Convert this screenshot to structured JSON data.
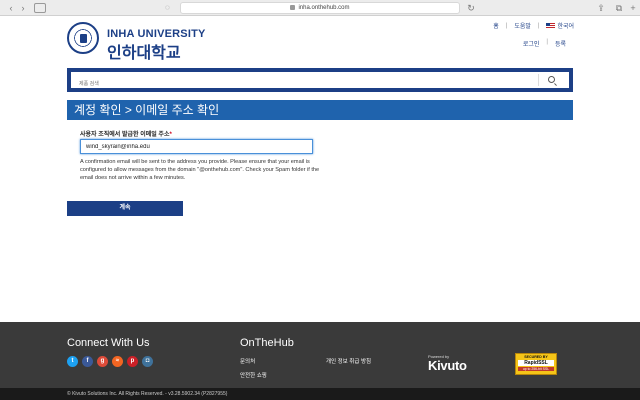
{
  "browser": {
    "url": "inha.onthehub.com"
  },
  "header": {
    "logo_en": "INHA UNIVERSITY",
    "logo_ko": "인하대학교",
    "top_links": [
      "홈",
      "도움말",
      "한국어"
    ],
    "login": "로그인",
    "register": "등록"
  },
  "search": {
    "placeholder": "제품 검색"
  },
  "page": {
    "title": "계정 확인 > 이메일 주소 확인",
    "email_label": "사용자 조직에서 발급한 이메일 주소",
    "required_mark": "*",
    "email_value": "wind_skyrain@inha.edu",
    "help_text": "A confirmation email will be sent to the address you provide. Please ensure that your email is configured to allow messages from the domain \"@onthehub.com\". Check your Spam folder if the email does not arrive within a few minutes.",
    "continue_label": "계속"
  },
  "footer": {
    "connect_title": "Connect With Us",
    "social_icons": [
      "twitter-icon",
      "facebook-icon",
      "googleplus-icon",
      "rss-icon",
      "pinterest-icon",
      "instagram-icon"
    ],
    "social_colors": [
      "#1da1f2",
      "#3b5998",
      "#dd4b39",
      "#f26522",
      "#cb2027",
      "#3f729b"
    ],
    "onthehub_title": "OnTheHub",
    "links": [
      "문의처",
      "안전한 쇼핑",
      "개인 정보 취급 방침"
    ],
    "powered_by": "Powered by",
    "kivuto": "Kivuto",
    "ssl_top": "SECURED BY",
    "ssl_mid": "RapidSSL",
    "ssl_bot": "up to 256-bit SSL",
    "copyright": "© Kivuto Solutions Inc. All Rights Reserved. - v3.28.5902.34 (P2827955)"
  }
}
